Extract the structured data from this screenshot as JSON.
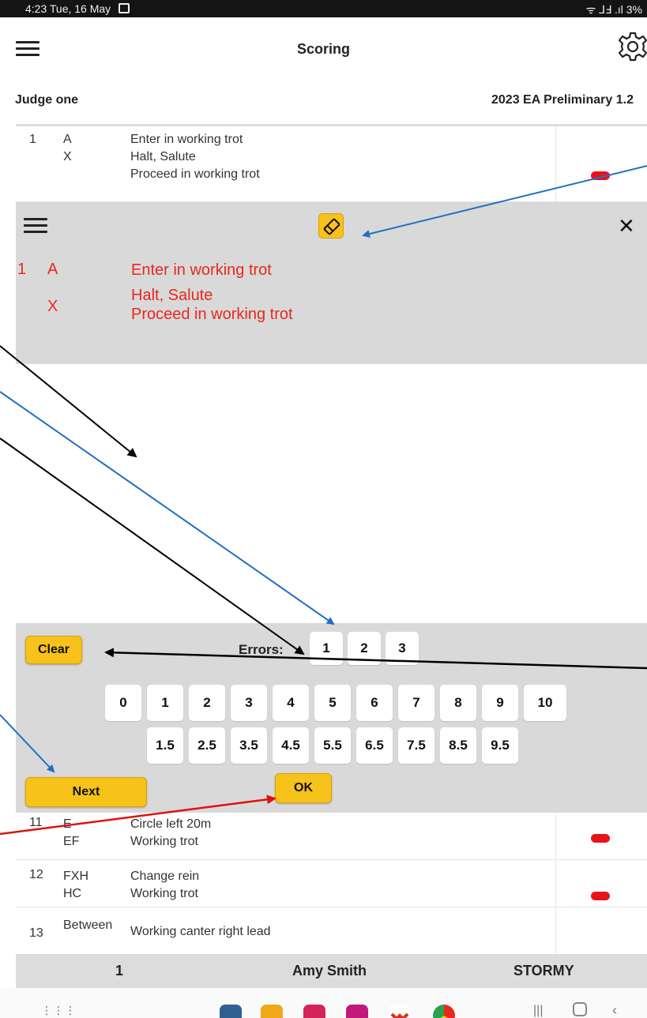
{
  "status_bar": {
    "time_date": "4:23  Tue, 16 May",
    "indicators": "ᯤ  ⅃Ⅎ .ıl 3%"
  },
  "app_bar": {
    "title": "Scoring"
  },
  "subheader": {
    "judge": "Judge one",
    "test": "2023 EA Preliminary 1.2"
  },
  "movements_top": [
    {
      "number": "1",
      "letters": [
        "A",
        "X"
      ],
      "text": [
        "Enter in working trot",
        "Halt, Salute",
        "Proceed in working trot"
      ]
    }
  ],
  "detail": {
    "number": "1",
    "letters": [
      "A",
      "X"
    ],
    "text": [
      "Enter in working trot",
      "Halt, Salute",
      "Proceed in working trot"
    ]
  },
  "scoring": {
    "clear_label": "Clear",
    "errors_label": "Errors:",
    "errors": [
      "1",
      "2",
      "3"
    ],
    "scores_row1": [
      "0",
      "1",
      "2",
      "3",
      "4",
      "5",
      "6",
      "7",
      "8",
      "9",
      "10"
    ],
    "scores_row2": [
      "1.5",
      "2.5",
      "3.5",
      "4.5",
      "5.5",
      "6.5",
      "7.5",
      "8.5",
      "9.5"
    ],
    "next_label": "Next",
    "ok_label": "OK"
  },
  "movements_bottom": [
    {
      "number": "11",
      "letters": [
        "E",
        "EF"
      ],
      "text": [
        "Circle left 20m",
        "Working trot"
      ]
    },
    {
      "number": "12",
      "letters": [
        "FXH",
        "HC"
      ],
      "text": [
        "Change rein",
        "Working trot"
      ]
    },
    {
      "number": "13",
      "letters": [
        "Between"
      ],
      "text": [
        "Working canter right lead"
      ]
    }
  ],
  "info_bar": {
    "rider_number": "1",
    "rider_name": "Amy Smith",
    "horse": "STORMY"
  },
  "colors": {
    "accent_yellow": "#f7c21a",
    "movement_red": "#e8281e",
    "score_pill": "#e8141c",
    "panel_grey": "#d9d9d9",
    "arrow_blue": "#1e6fc4",
    "arrow_black": "#000000",
    "arrow_red": "#e01010"
  }
}
